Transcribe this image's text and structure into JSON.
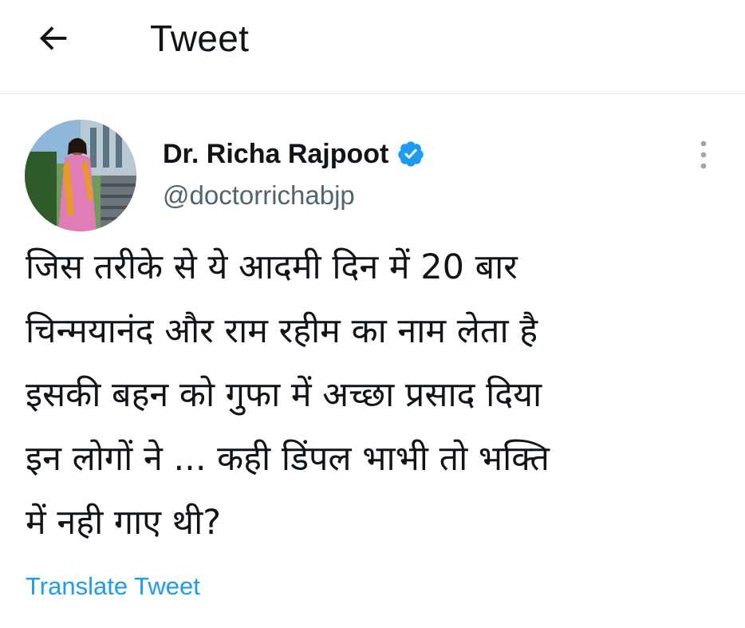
{
  "header": {
    "title": "Tweet",
    "back_icon": "arrow-left-icon"
  },
  "author": {
    "display_name": "Dr. Richa Rajpoot",
    "handle": "@doctorrichabjp",
    "verified": true,
    "verified_color": "#1d9bf0",
    "avatar_icon": "profile-photo"
  },
  "tweet": {
    "lines": [
      "जिस तरीके से ये आदमी दिन में 20 बार",
      "चिन्मयानंद और राम रहीम का नाम लेता है",
      "इसकी बहन को गुफा में अच्छा प्रसाद दिया",
      "इन लोगों ने ... कही डिंपल भाभी तो भक्ति",
      "में नही गाए थी?"
    ]
  },
  "translate_label": "Translate Tweet",
  "colors": {
    "text": "#0f1419",
    "secondary": "#536471",
    "accent": "#1d9bf0",
    "divider": "#e6e9eb"
  }
}
